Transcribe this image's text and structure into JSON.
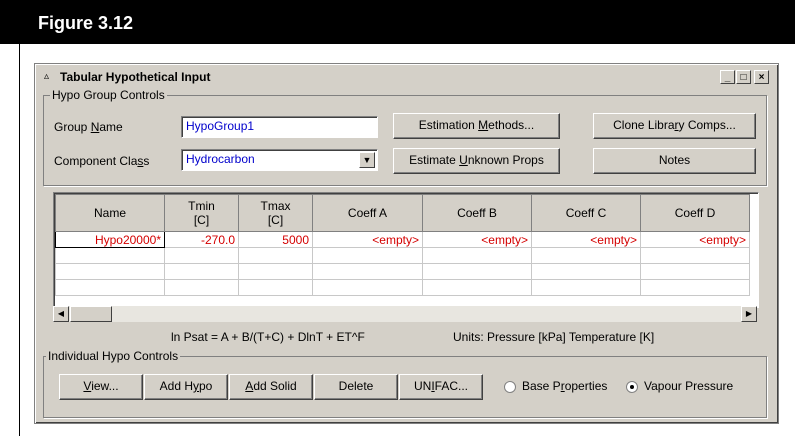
{
  "figure": {
    "title": "Figure 3.12"
  },
  "window": {
    "title": "Tabular Hypothetical Input",
    "buttons": {
      "minimize": "_",
      "maximize": "□",
      "close": "×"
    }
  },
  "hypo_group_controls": {
    "legend": "Hypo Group Controls",
    "group_name_label": "Group Name",
    "group_name_value": "HypoGroup1",
    "component_class_label": "Component Class",
    "component_class_value": "Hydrocarbon",
    "estimation_methods_button": "Estimation Methods...",
    "clone_library_button": "Clone Library Comps...",
    "estimate_unknown_button": "Estimate Unknown Props",
    "notes_button": "Notes"
  },
  "table": {
    "headers": [
      "Name",
      "Tmin\n[C]",
      "Tmax\n[C]",
      "Coeff A",
      "Coeff B",
      "Coeff C",
      "Coeff D"
    ],
    "rows": [
      [
        "Hypo20000*",
        "-270.0",
        "5000",
        "<empty>",
        "<empty>",
        "<empty>",
        "<empty>"
      ],
      [
        "",
        "",
        "",
        "",
        "",
        "",
        ""
      ],
      [
        "",
        "",
        "",
        "",
        "",
        "",
        ""
      ],
      [
        "",
        "",
        "",
        "",
        "",
        "",
        ""
      ],
      [
        "",
        "",
        "",
        "",
        "",
        "",
        ""
      ]
    ]
  },
  "equation": "ln Psat  = A + B/(T+C) + DlnT + ET^F",
  "units": "Units: Pressure [kPa]  Temperature [K]",
  "individual_hypo_controls": {
    "legend": "Individual Hypo Controls",
    "view_button": "View...",
    "add_hypo_button": "Add Hypo",
    "add_solid_button": "Add Solid",
    "delete_button": "Delete",
    "unifac_button": "UNIFAC...",
    "radio_base": "Base Properties",
    "radio_vapour": "Vapour Pressure",
    "selected": "Vapour Pressure"
  }
}
